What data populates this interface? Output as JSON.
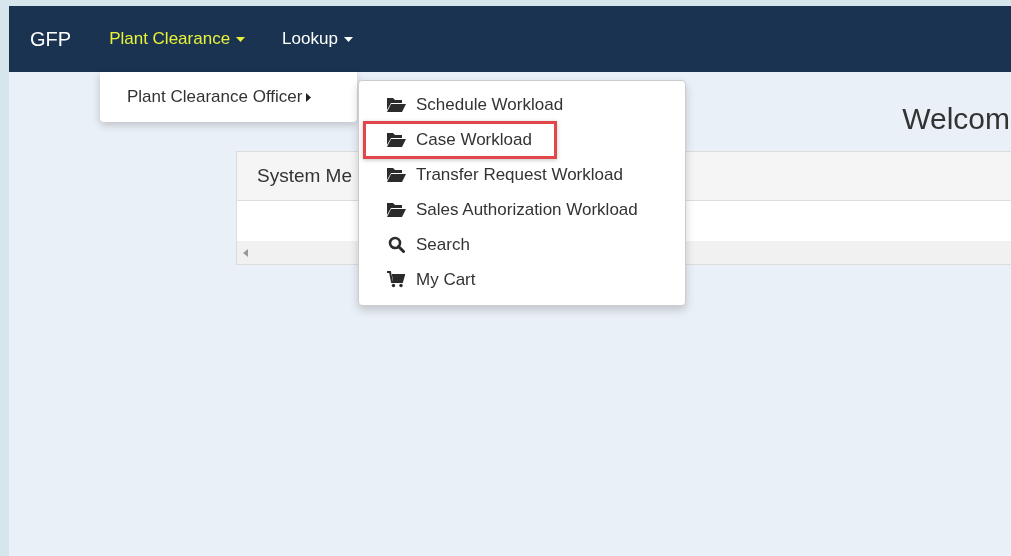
{
  "navbar": {
    "brand": "GFP",
    "menus": [
      {
        "label": "Plant Clearance",
        "selected": true
      },
      {
        "label": "Lookup",
        "selected": false
      }
    ]
  },
  "submenu": {
    "items": [
      {
        "label": "Plant Clearance Officer"
      }
    ]
  },
  "flyout": {
    "items": [
      {
        "label": "Schedule Workload",
        "kind": "folder",
        "highlighted": false
      },
      {
        "label": "Case Workload",
        "kind": "folder",
        "highlighted": true
      },
      {
        "label": "Transfer Request Workload",
        "kind": "folder",
        "highlighted": false
      },
      {
        "label": "Sales Authorization Workload",
        "kind": "folder",
        "highlighted": false
      },
      {
        "label": "Search",
        "kind": "search",
        "highlighted": false
      },
      {
        "label": "My Cart",
        "kind": "cart",
        "highlighted": false
      }
    ]
  },
  "welcome": {
    "title": "Welcom"
  },
  "card": {
    "header": "System Me"
  }
}
